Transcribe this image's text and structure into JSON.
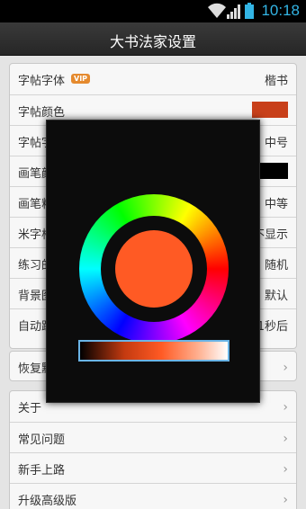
{
  "status_bar": {
    "time": "10:18"
  },
  "header": {
    "title": "大书法家设置"
  },
  "settings": {
    "font": {
      "label": "字帖字体",
      "badge": "VIP",
      "value": "楷书"
    },
    "font_color": {
      "label": "字帖颜色",
      "swatch_color": "#c8401a"
    },
    "font_size": {
      "label": "字帖字号",
      "value": "中号"
    },
    "brush_color": {
      "label": "画笔颜色",
      "swatch_color": "#000000"
    },
    "brush_width": {
      "label": "画笔粗细",
      "value": "中等"
    },
    "grid": {
      "label": "米字格",
      "value": "不显示"
    },
    "practice_order": {
      "label": "练习的顺序",
      "value": "随机"
    },
    "background": {
      "label": "背景图片",
      "value": "默认"
    },
    "auto_next": {
      "label": "自动跳到下一字",
      "value": "1秒后"
    }
  },
  "restore": {
    "label": "恢复默认设置"
  },
  "info_items": [
    "关于",
    "常见问题",
    "新手上路",
    "升级高级版"
  ],
  "color_picker": {
    "selected_color": "#ff5a24"
  },
  "colors": {
    "accent": "#33b5e5",
    "vip_badge": "#e58a2e"
  }
}
